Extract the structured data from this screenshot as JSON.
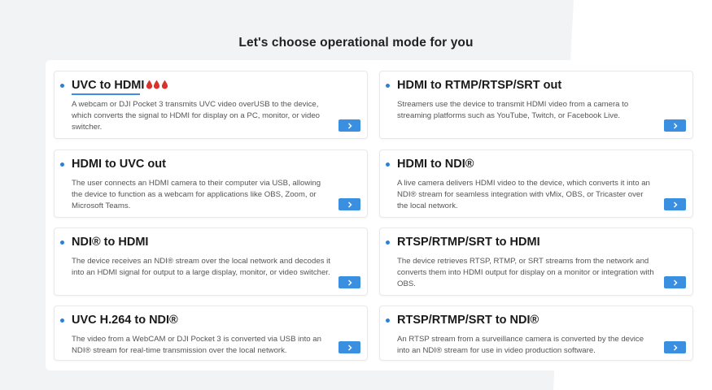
{
  "page": {
    "title": "Let's choose operational mode for you"
  },
  "colors": {
    "accent": "#3b8fe0",
    "drop": "#d9342b"
  },
  "cards": [
    {
      "title": "UVC to HDMI",
      "desc": "A webcam or DJI Pocket 3 transmits UVC video overUSB to the device, which converts the signal to HDMI for display on a PC, monitor, or video switcher.",
      "selected": true
    },
    {
      "title": "HDMI to RTMP/RTSP/SRT out",
      "desc": "Streamers use the device to transmit HDMI video from a camera to streaming platforms such as YouTube, Twitch, or Facebook Live."
    },
    {
      "title": "HDMI to UVC out",
      "desc": "The user connects an HDMI camera to their computer via USB, allowing the device to function as a webcam for applications like OBS, Zoom, or Microsoft Teams."
    },
    {
      "title": "HDMI to NDI®",
      "desc": "A live camera delivers HDMI video to the device, which converts it into an NDI® stream for seamless integration with vMix, OBS, or Tricaster over the local network."
    },
    {
      "title": "NDI® to HDMI",
      "desc": "The device receives an NDI® stream over the local network and decodes it into an HDMI signal for output to a large display, monitor, or video switcher."
    },
    {
      "title": "RTSP/RTMP/SRT to HDMI",
      "desc": "The device retrieves RTSP, RTMP, or SRT streams from the network and converts them into HDMI output for display on a monitor or integration with OBS."
    },
    {
      "title": "UVC H.264 to NDI®",
      "desc": "The video from a WebCAM or DJI Pocket 3 is converted via USB into an NDI® stream for real-time transmission over the local network."
    },
    {
      "title": "RTSP/RTMP/SRT to NDI®",
      "desc": "An RTSP stream from a surveillance camera is converted by the device into an NDI® stream for use in video production software."
    }
  ]
}
